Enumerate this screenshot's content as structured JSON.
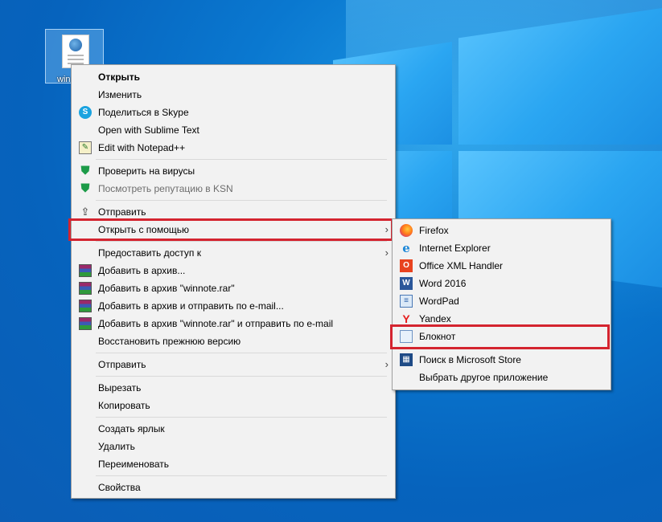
{
  "desktop": {
    "file_icon_label": "win"
  },
  "context_menu": {
    "items": [
      {
        "label": "Открыть"
      },
      {
        "label": "Изменить"
      },
      {
        "label": "Поделиться в Skype"
      },
      {
        "label": "Open with Sublime Text"
      },
      {
        "label": "Edit with Notepad++"
      },
      {
        "label": "Проверить на вирусы"
      },
      {
        "label": "Посмотреть репутацию в KSN"
      },
      {
        "label": "Отправить"
      },
      {
        "label": "Открыть с помощью"
      },
      {
        "label": "Предоставить доступ к"
      },
      {
        "label": "Добавить в архив..."
      },
      {
        "label": "Добавить в архив \"winnote.rar\""
      },
      {
        "label": "Добавить в архив и отправить по e-mail..."
      },
      {
        "label": "Добавить в архив \"winnote.rar\" и отправить по e-mail"
      },
      {
        "label": "Восстановить прежнюю версию"
      },
      {
        "label": "Отправить"
      },
      {
        "label": "Вырезать"
      },
      {
        "label": "Копировать"
      },
      {
        "label": "Создать ярлык"
      },
      {
        "label": "Удалить"
      },
      {
        "label": "Переименовать"
      },
      {
        "label": "Свойства"
      }
    ]
  },
  "open_with_submenu": {
    "items": [
      {
        "label": "Firefox"
      },
      {
        "label": "Internet Explorer"
      },
      {
        "label": "Office XML Handler"
      },
      {
        "label": "Word 2016"
      },
      {
        "label": "WordPad"
      },
      {
        "label": "Yandex"
      },
      {
        "label": "Блокнот"
      },
      {
        "label": "Поиск в Microsoft Store"
      },
      {
        "label": "Выбрать другое приложение"
      }
    ]
  },
  "colors": {
    "highlight": "#d4242f",
    "desktop_bg": "#0a78d0"
  },
  "icons": {
    "skype": "skype-icon",
    "shield": "shield-icon",
    "winrar": "winrar-icon",
    "notepadpp": "notepadpp-icon",
    "share": "share-icon",
    "firefox": "firefox-icon",
    "ie": "internet-explorer-icon",
    "office": "office-icon",
    "word": "word-icon",
    "wordpad": "wordpad-icon",
    "yandex": "yandex-icon",
    "notepad": "notepad-icon",
    "store": "microsoft-store-icon"
  }
}
